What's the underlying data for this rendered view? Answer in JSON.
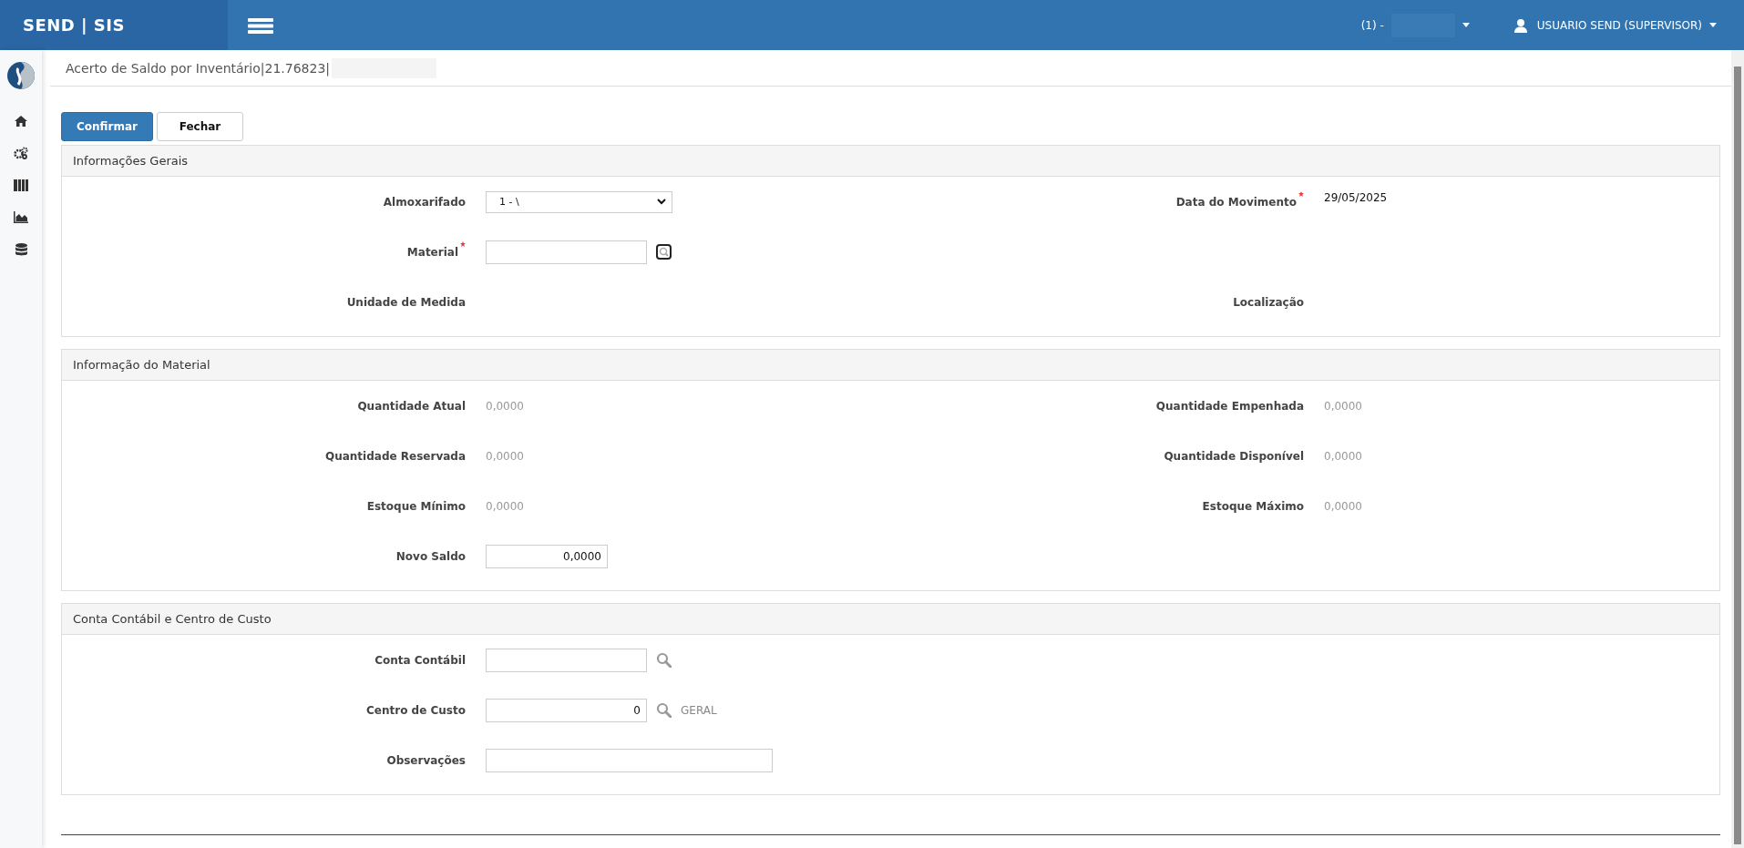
{
  "header": {
    "brand": "SEND | SIS",
    "company": "(1) -",
    "user": "USUARIO SEND (SUPERVISOR)"
  },
  "page_title": "Acerto de Saldo por Inventário|21.76823|",
  "buttons": [
    {
      "label": "Confirmar",
      "kind": "primary"
    },
    {
      "label": "Fechar",
      "kind": "default"
    }
  ],
  "sections": [
    {
      "title": "Informações Gerais",
      "rows": [
        [
          {
            "label": "Almoxarifado",
            "kind": "select",
            "value": "1 - \\",
            "required": false
          },
          {
            "label": "Data do Movimento",
            "kind": "text",
            "value": "29/05/2025",
            "required": true
          }
        ],
        [
          {
            "label": "Material",
            "kind": "input",
            "required": true,
            "lookup": {
              "kind": "boxed"
            }
          }
        ],
        [
          {
            "label": "Unidade de Medida",
            "kind": "empty",
            "required": false
          },
          {
            "label": "Localização",
            "kind": "empty",
            "required": false
          }
        ]
      ]
    },
    {
      "title": "Informação do Material",
      "rows": [
        [
          {
            "label": "Quantidade Atual",
            "kind": "readout",
            "value": "0,0000",
            "required": false
          },
          {
            "label": "Quantidade Empenhada",
            "kind": "readout",
            "value": "0,0000",
            "required": false
          }
        ],
        [
          {
            "label": "Quantidade Reservada",
            "kind": "readout",
            "value": "0,0000",
            "required": false
          },
          {
            "label": "Quantidade Disponível",
            "kind": "readout",
            "value": "0,0000",
            "required": false
          }
        ],
        [
          {
            "label": "Estoque Mínimo",
            "kind": "readout",
            "value": "0,0000",
            "required": false
          },
          {
            "label": "Estoque Máximo",
            "kind": "readout",
            "value": "0,0000",
            "required": false
          }
        ],
        [
          {
            "label": "Novo Saldo",
            "kind": "quantity-input",
            "value": "0,0000",
            "required": false
          }
        ]
      ]
    },
    {
      "title": "Conta Contábil e Centro de Custo",
      "rows": [
        [
          {
            "label": "Conta Contábil",
            "kind": "input",
            "required": false,
            "lookup": {
              "kind": "plain"
            }
          }
        ],
        [
          {
            "label": "Centro de Custo",
            "kind": "code-input",
            "value": "0",
            "required": false,
            "lookup": {
              "kind": "plain"
            },
            "note": "GERAL"
          }
        ],
        [
          {
            "label": "Observações",
            "kind": "memo-input",
            "required": false
          }
        ]
      ]
    }
  ]
}
